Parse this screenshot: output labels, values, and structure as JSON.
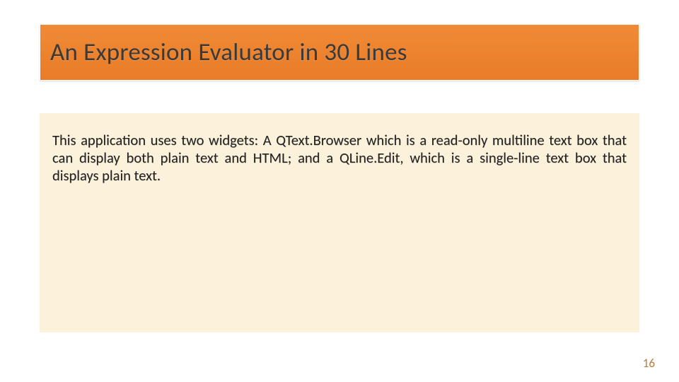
{
  "slide": {
    "title": "An Expression Evaluator in 30 Lines",
    "body": "This application uses two widgets: A QText.Browser which is a read-only multiline text box that can display both plain text and HTML; and a QLine.Edit, which is a single-line text box that displays plain text.",
    "page_number": "16"
  },
  "colors": {
    "title_bar_gradient_top": "#f08a36",
    "title_bar_gradient_bottom": "#e97c28",
    "body_background": "#fcf2dc",
    "page_number_color": "#b97a3f"
  }
}
